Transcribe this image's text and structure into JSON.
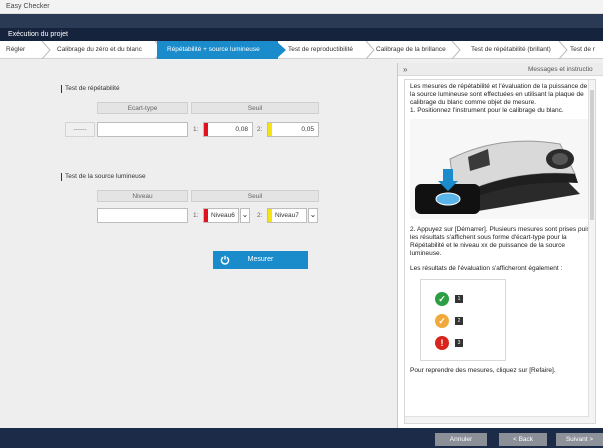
{
  "window": {
    "title": "Easy Checker"
  },
  "app": {
    "title": "Exécution du projet"
  },
  "steps": [
    {
      "label": "Régler"
    },
    {
      "label": "Calibrage du zéro et du blanc"
    },
    {
      "label": "Répétabilité + source lumineuse"
    },
    {
      "label": "Test de reproductibilité"
    },
    {
      "label": "Calibrage de la brillance"
    },
    {
      "label": "Test de répétabilité (brillant)"
    },
    {
      "label": "Test de r"
    }
  ],
  "repeat_test": {
    "title": "Test de répétabilité",
    "col_ecart": "Ecart-type",
    "col_seuil": "Seuil",
    "dash": "------",
    "th1_label": "1:",
    "th1_value": "0,08",
    "th2_label": "2:",
    "th2_value": "0,05"
  },
  "light_test": {
    "title": "Test de la source lumineuse",
    "col_niveau": "Niveau",
    "col_seuil": "Seuil",
    "th1_label": "1:",
    "th1_value": "Niveau6",
    "th2_label": "2:",
    "th2_value": "Niveau7"
  },
  "measure_button": {
    "label": "Mesurer"
  },
  "messages": {
    "header": "Messages et instructio",
    "collapse": "»",
    "p1": "Les mesures de répétabilité et l'évaluation de la puissance de la source lumineuse sont effectuées en utilisant la plaque de calibrage du blanc comme objet de mesure.",
    "p2": "1. Positionnez l'instrument pour le calibrage du blanc.",
    "p3": "2. Appuyez sur [Démarrer]. Plusieurs mesures sont prises puis les résultats s'affichent sous forme d'écart-type pour la Répétabilité et le niveau xx de puissance de la source lumineuse.",
    "p4": "Les résultats de l'évaluation s'afficheront également :",
    "ev1": "1",
    "ev2": "2",
    "ev3": "3",
    "ev3_icon": "!",
    "p5": "Pour reprendre des mesures, cliquez sur [Refaire]."
  },
  "footer": {
    "cancel": "Annuler",
    "back": "< Back",
    "next": "Suivant >"
  },
  "colors": {
    "accent": "#1a8ccc",
    "header_dark": "#16233d",
    "threshold1": "#e0141e",
    "threshold2": "#f5e313",
    "ok": "#2e9e44",
    "warn": "#f2a93b",
    "error": "#d9231d"
  }
}
